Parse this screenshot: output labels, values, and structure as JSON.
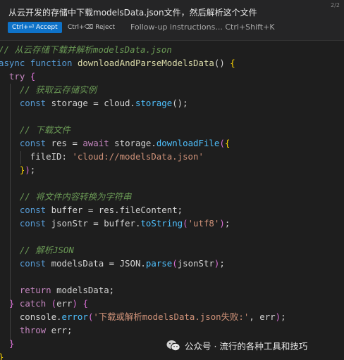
{
  "prompt": {
    "text": "从云开发的存储中下载modelsData.json文件，然后解析这个文件",
    "counter": "2/2"
  },
  "actions": {
    "accept_label": "Ctrl+⏎ Accept",
    "reject_label": "Ctrl+⌫ Reject",
    "followup_placeholder": "Follow-up instructions... Ctrl+Shift+K"
  },
  "code_lines": [
    [
      {
        "t": "// 从云存储下载并解析modelsData.json",
        "c": "comment"
      }
    ],
    [
      {
        "t": "async",
        "c": "keyword"
      },
      {
        "t": " ",
        "c": "plain"
      },
      {
        "t": "function",
        "c": "keyword"
      },
      {
        "t": " ",
        "c": "plain"
      },
      {
        "t": "downloadAndParseModelsData",
        "c": "func"
      },
      {
        "t": "() ",
        "c": "plain"
      },
      {
        "t": "{",
        "c": "brace"
      }
    ],
    [
      {
        "t": "  ",
        "c": "plain"
      },
      {
        "t": "try",
        "c": "control"
      },
      {
        "t": " ",
        "c": "plain"
      },
      {
        "t": "{",
        "c": "paren"
      }
    ],
    [
      {
        "t": "    ",
        "c": "plain"
      },
      {
        "t": "// 获取云存储实例",
        "c": "comment"
      }
    ],
    [
      {
        "t": "    ",
        "c": "plain"
      },
      {
        "t": "const",
        "c": "keyword"
      },
      {
        "t": " storage = cloud.",
        "c": "plain"
      },
      {
        "t": "storage",
        "c": "method"
      },
      {
        "t": "();",
        "c": "plain"
      }
    ],
    [],
    [
      {
        "t": "    ",
        "c": "plain"
      },
      {
        "t": "// 下载文件",
        "c": "comment"
      }
    ],
    [
      {
        "t": "    ",
        "c": "plain"
      },
      {
        "t": "const",
        "c": "keyword"
      },
      {
        "t": " res = ",
        "c": "plain"
      },
      {
        "t": "await",
        "c": "control"
      },
      {
        "t": " storage.",
        "c": "plain"
      },
      {
        "t": "downloadFile",
        "c": "method"
      },
      {
        "t": "(",
        "c": "paren"
      },
      {
        "t": "{",
        "c": "brace"
      }
    ],
    [
      {
        "t": "      fileID: ",
        "c": "plain"
      },
      {
        "t": "'cloud://modelsData.json'",
        "c": "string"
      }
    ],
    [
      {
        "t": "    ",
        "c": "plain"
      },
      {
        "t": "}",
        "c": "brace"
      },
      {
        "t": ")",
        "c": "paren"
      },
      {
        "t": ";",
        "c": "plain"
      }
    ],
    [],
    [
      {
        "t": "    ",
        "c": "plain"
      },
      {
        "t": "// 将文件内容转换为字符串",
        "c": "comment"
      }
    ],
    [
      {
        "t": "    ",
        "c": "plain"
      },
      {
        "t": "const",
        "c": "keyword"
      },
      {
        "t": " buffer = res.fileContent;",
        "c": "plain"
      }
    ],
    [
      {
        "t": "    ",
        "c": "plain"
      },
      {
        "t": "const",
        "c": "keyword"
      },
      {
        "t": " jsonStr = buffer.",
        "c": "plain"
      },
      {
        "t": "toString",
        "c": "method"
      },
      {
        "t": "(",
        "c": "paren"
      },
      {
        "t": "'utf8'",
        "c": "string"
      },
      {
        "t": ")",
        "c": "paren"
      },
      {
        "t": ";",
        "c": "plain"
      }
    ],
    [],
    [
      {
        "t": "    ",
        "c": "plain"
      },
      {
        "t": "// 解析JSON",
        "c": "comment"
      }
    ],
    [
      {
        "t": "    ",
        "c": "plain"
      },
      {
        "t": "const",
        "c": "keyword"
      },
      {
        "t": " modelsData = JSON.",
        "c": "plain"
      },
      {
        "t": "parse",
        "c": "method"
      },
      {
        "t": "(",
        "c": "paren"
      },
      {
        "t": "jsonStr",
        "c": "plain"
      },
      {
        "t": ")",
        "c": "paren"
      },
      {
        "t": ";",
        "c": "plain"
      }
    ],
    [],
    [
      {
        "t": "    ",
        "c": "plain"
      },
      {
        "t": "return",
        "c": "control"
      },
      {
        "t": " modelsData;",
        "c": "plain"
      }
    ],
    [
      {
        "t": "  ",
        "c": "plain"
      },
      {
        "t": "}",
        "c": "paren"
      },
      {
        "t": " ",
        "c": "plain"
      },
      {
        "t": "catch",
        "c": "control"
      },
      {
        "t": " ",
        "c": "plain"
      },
      {
        "t": "(",
        "c": "paren"
      },
      {
        "t": "err",
        "c": "plain"
      },
      {
        "t": ")",
        "c": "paren"
      },
      {
        "t": " ",
        "c": "plain"
      },
      {
        "t": "{",
        "c": "paren"
      }
    ],
    [
      {
        "t": "    console.",
        "c": "plain"
      },
      {
        "t": "error",
        "c": "method"
      },
      {
        "t": "(",
        "c": "paren"
      },
      {
        "t": "'下载或解析modelsData.json失败:'",
        "c": "string"
      },
      {
        "t": ", err",
        "c": "plain"
      },
      {
        "t": ")",
        "c": "paren"
      },
      {
        "t": ";",
        "c": "plain"
      }
    ],
    [
      {
        "t": "    ",
        "c": "plain"
      },
      {
        "t": "throw",
        "c": "control"
      },
      {
        "t": " err;",
        "c": "plain"
      }
    ],
    [
      {
        "t": "  ",
        "c": "plain"
      },
      {
        "t": "}",
        "c": "paren"
      }
    ],
    [
      {
        "t": "}",
        "c": "brace"
      }
    ]
  ],
  "watermark": {
    "text": "公众号 · 流行的各种工具和技巧",
    "icon": "wechat-icon"
  },
  "colors": {
    "accent": "#0e72c8",
    "editor_bg": "#1e1e1e",
    "comment": "#6a9955",
    "keyword": "#569cd6",
    "string": "#ce9178"
  }
}
